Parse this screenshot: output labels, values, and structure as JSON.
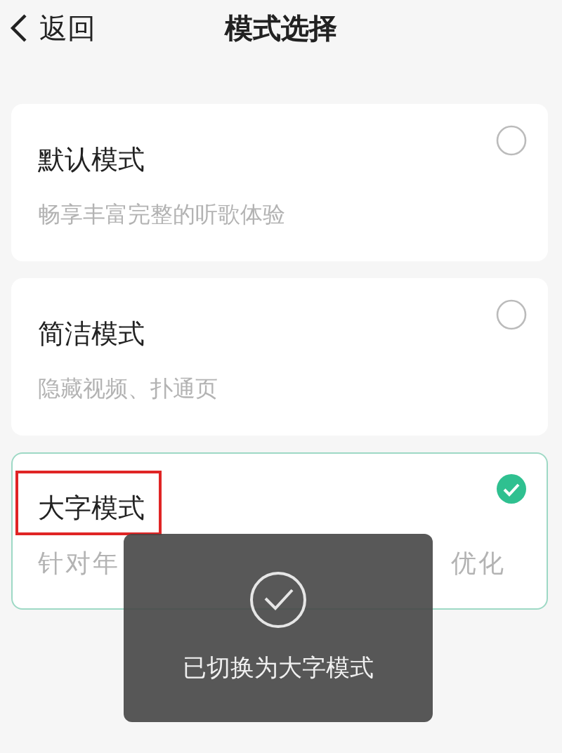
{
  "header": {
    "back_label": "返回",
    "title": "模式选择"
  },
  "modes": [
    {
      "title": "默认模式",
      "subtitle": "畅享丰富完整的听歌体验",
      "selected": false,
      "highlighted": false
    },
    {
      "title": "简洁模式",
      "subtitle": "隐藏视频、扑通页",
      "selected": false,
      "highlighted": false
    },
    {
      "title": "大字模式",
      "subtitle_parts": [
        "针对年",
        "优化"
      ],
      "selected": true,
      "highlighted": true
    }
  ],
  "toast": {
    "message": "已切换为大字模式"
  }
}
